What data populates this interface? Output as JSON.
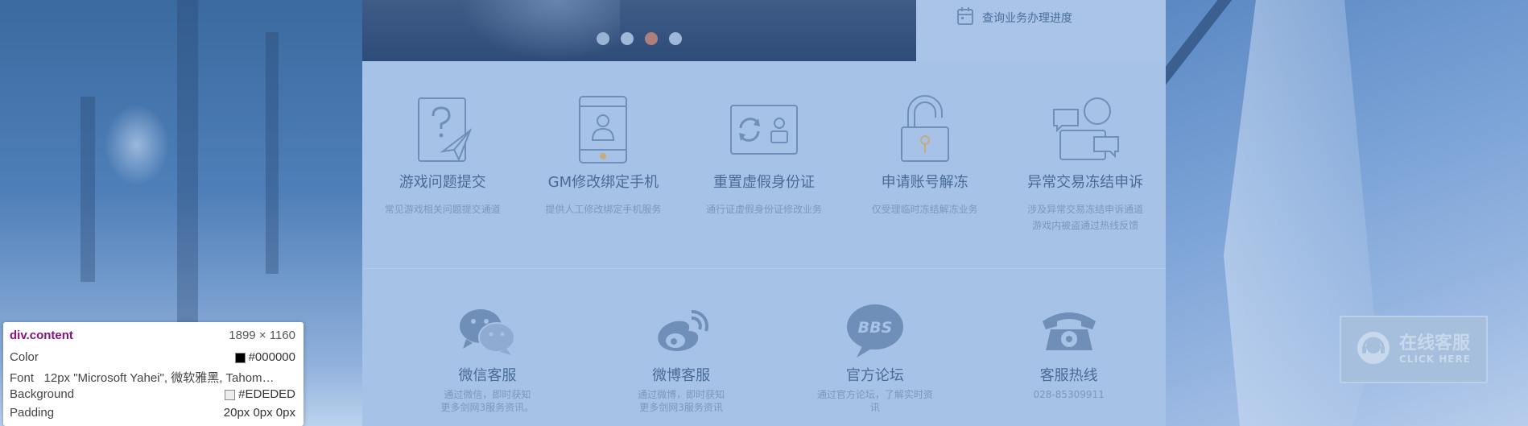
{
  "colors": {
    "page_bg": "#3a6ea8",
    "content_bg": "#a6c2e7",
    "icon_stroke": "#6f8fb9",
    "title_text": "#4a6b97",
    "desc_text": "#7e97bb",
    "dot_active": "#b07f7c",
    "dot_inactive": "#9fb8d8"
  },
  "banner": {
    "slide_count": 4,
    "active_slide": 3
  },
  "progress_panel": {
    "link_label": "查询业务办理进度",
    "icon": "calendar-icon"
  },
  "services": [
    {
      "title": "游戏问题提交",
      "desc": "常见游戏相关问题提交通道",
      "icon": "question-paper-plane-icon"
    },
    {
      "title": "GM修改绑定手机",
      "desc": "提供人工修改绑定手机服务",
      "icon": "phone-user-icon"
    },
    {
      "title": "重置虚假身份证",
      "desc": "通行证虚假身份证修改业务",
      "icon": "id-card-refresh-icon"
    },
    {
      "title": "申请账号解冻",
      "desc": "仅受理临时冻结解冻业务",
      "icon": "unlock-icon"
    },
    {
      "title": "异常交易冻结申诉",
      "desc": "涉及异常交易冻结申诉通道\n游戏内被盗通过热线反馈",
      "icon": "chat-bubbles-icon"
    }
  ],
  "contacts": [
    {
      "title": "微信客服",
      "desc": "通过微信，即时获知\n更多剑网3服务资讯。",
      "icon": "wechat-icon"
    },
    {
      "title": "微博客服",
      "desc": "通过微博，即时获知\n更多剑网3服务资讯",
      "icon": "weibo-icon"
    },
    {
      "title": "官方论坛",
      "desc": "通过官方论坛，了解实时资讯",
      "icon": "bbs-icon"
    },
    {
      "title": "客服热线",
      "desc": "028-85309911",
      "icon": "telephone-icon"
    }
  ],
  "online_service": {
    "label": "在线客服",
    "sub_label": "CLICK HERE",
    "icon": "headset-icon"
  },
  "inspector_tooltip": {
    "selector": "div.content",
    "size": "1899 × 1160",
    "rows": [
      {
        "key": "Color",
        "value": "#000000",
        "swatch": "#000000"
      },
      {
        "key": "Font",
        "value": "12px \"Microsoft Yahei\", 微软雅黑, Tahom…",
        "swatch": ""
      },
      {
        "key": "Background",
        "value": "#EDEDED",
        "swatch": "#EDEDED"
      },
      {
        "key": "Padding",
        "value": "20px 0px 0px",
        "swatch": ""
      }
    ]
  }
}
